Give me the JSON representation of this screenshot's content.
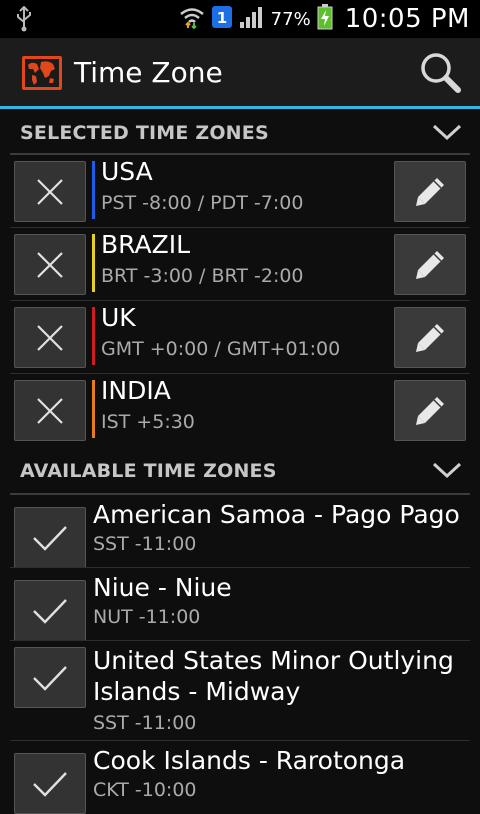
{
  "status": {
    "battery_pct": "77%",
    "time": "10:05 PM"
  },
  "action_bar": {
    "title": "Time Zone"
  },
  "selected": {
    "header": "SELECTED TIME ZONES",
    "items": [
      {
        "name": "USA",
        "offset": "PST -8:00 / PDT -7:00",
        "color": "#1e5ee6"
      },
      {
        "name": "BRAZIL",
        "offset": "BRT -3:00 / BRT -2:00",
        "color": "#e6d21e"
      },
      {
        "name": "UK",
        "offset": "GMT +0:00 / GMT+01:00",
        "color": "#d01e1e"
      },
      {
        "name": "INDIA",
        "offset": "IST +5:30",
        "color": "#e67e1e"
      }
    ]
  },
  "available": {
    "header": "AVAILABLE TIME ZONES",
    "items": [
      {
        "name": "American Samoa - Pago Pago",
        "offset": "SST -11:00"
      },
      {
        "name": "Niue - Niue",
        "offset": "NUT -11:00"
      },
      {
        "name": "United States Minor Outlying Islands - Midway",
        "offset": "SST -11:00"
      },
      {
        "name": "Cook Islands - Rarotonga",
        "offset": "CKT -10:00"
      }
    ]
  },
  "colors": {
    "accent": "#33b5e5"
  },
  "icons": {
    "remove": "close-icon",
    "edit": "pencil-icon",
    "add": "check-icon",
    "search": "search-icon",
    "collapse": "chevron-down-icon"
  }
}
